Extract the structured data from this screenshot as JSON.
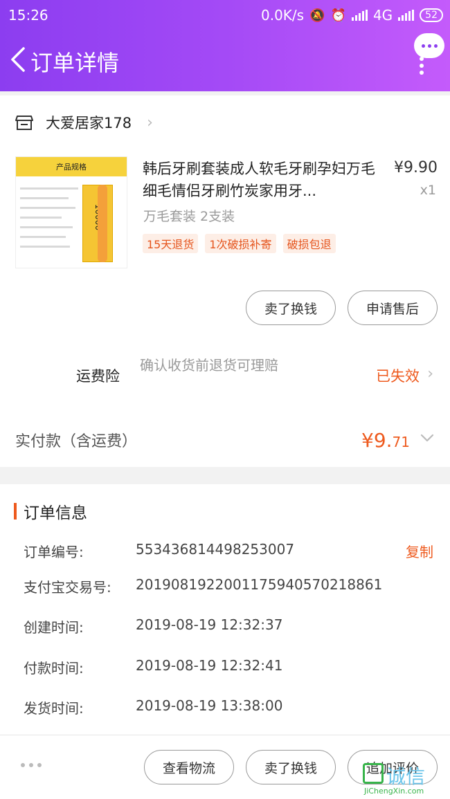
{
  "status_bar": {
    "time": "15:26",
    "net_speed": "0.0K/s",
    "network": "4G",
    "battery": "52"
  },
  "header": {
    "title": "订单详情"
  },
  "shop": {
    "name": "大爱居家178"
  },
  "product": {
    "image_text": "产品规格",
    "image_pack_text": "10000",
    "title": "韩后牙刷套装成人软毛牙刷孕妇万毛细毛情侣牙刷竹炭家用牙...",
    "price": "¥9.90",
    "qty": "x1",
    "spec": "万毛套装 2支装",
    "tags": [
      "15天退货",
      "1次破损补寄",
      "破损包退"
    ]
  },
  "item_actions": {
    "sell_label": "卖了换钱",
    "after_sale_label": "申请售后"
  },
  "insurance": {
    "label": "运费险",
    "desc": "确认收货前退货可理赔",
    "status": "已失效"
  },
  "payment": {
    "label": "实付款（含运费）",
    "amount_main": "¥9.",
    "amount_cents": "71"
  },
  "order_info": {
    "title": "订单信息",
    "rows": [
      {
        "label": "订单编号:",
        "value": "553436814498253007",
        "action": "复制"
      },
      {
        "label": "支付宝交易号:",
        "value": "2019081922001175940570218861"
      },
      {
        "label": "创建时间:",
        "value": "2019-08-19 12:32:37"
      },
      {
        "label": "付款时间:",
        "value": "2019-08-19 12:32:41"
      },
      {
        "label": "发货时间:",
        "value": "2019-08-19 13:38:00"
      }
    ]
  },
  "bottom_bar": {
    "logistics_label": "查看物流",
    "sell_label": "卖了换钱",
    "review_label": "追加评价"
  },
  "watermark": {
    "text": "诚信",
    "url_text": "JiChengXin.com"
  },
  "colors": {
    "header_start": "#8c3df0",
    "header_end": "#c45bfb",
    "accent": "#ee5a1e"
  }
}
